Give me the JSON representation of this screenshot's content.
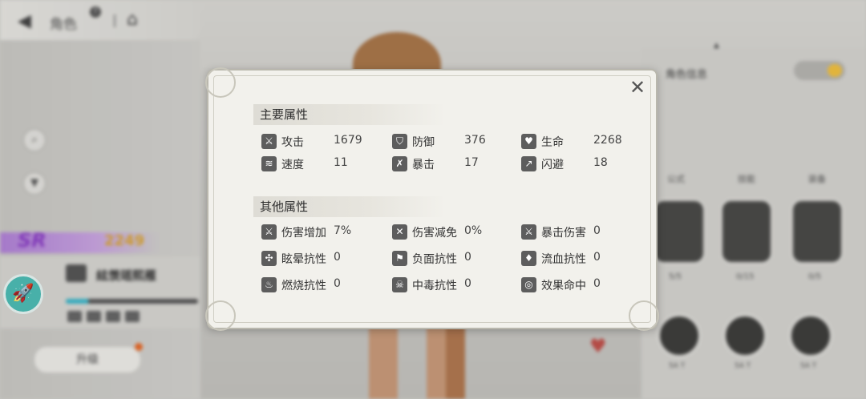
{
  "background": {
    "header": {
      "title": "角色",
      "help_badge": "?"
    },
    "left": {
      "rarity": "SR",
      "power": "2249",
      "char_name": "絃羡瑶熙雁",
      "level_progress": 0.17,
      "upgrade_label": "升级"
    },
    "right": {
      "title": "角色信息",
      "tabs": [
        "公式",
        "技能",
        "装备"
      ],
      "skill_labels": [
        "5/5",
        "0/15",
        "0/5"
      ],
      "equip_labels": [
        "5A T",
        "5A T",
        "5A T"
      ]
    }
  },
  "modal": {
    "main_title": "主要属性",
    "other_title": "其他属性",
    "main_attrs": [
      {
        "name": "攻击",
        "value": "1679",
        "icon": "sword-icon"
      },
      {
        "name": "防御",
        "value": "376",
        "icon": "shield-icon"
      },
      {
        "name": "生命",
        "value": "2268",
        "icon": "heart-icon"
      },
      {
        "name": "速度",
        "value": "11",
        "icon": "wind-icon"
      },
      {
        "name": "暴击",
        "value": "17",
        "icon": "crit-sword-icon"
      },
      {
        "name": "闪避",
        "value": "18",
        "icon": "dodge-runner-icon"
      }
    ],
    "other_attrs": [
      {
        "name": "伤害增加",
        "value": "7%",
        "icon": "damage-up-icon"
      },
      {
        "name": "伤害减免",
        "value": "0%",
        "icon": "damage-reduce-icon"
      },
      {
        "name": "暴击伤害",
        "value": "0",
        "icon": "crit-damage-icon"
      },
      {
        "name": "眩晕抗性",
        "value": "0",
        "icon": "stun-resist-icon"
      },
      {
        "name": "负面抗性",
        "value": "0",
        "icon": "debuff-resist-icon"
      },
      {
        "name": "流血抗性",
        "value": "0",
        "icon": "bleed-resist-icon"
      },
      {
        "name": "燃烧抗性",
        "value": "0",
        "icon": "burn-resist-icon"
      },
      {
        "name": "中毒抗性",
        "value": "0",
        "icon": "poison-skull-icon"
      },
      {
        "name": "效果命中",
        "value": "0",
        "icon": "effect-hit-icon"
      }
    ]
  }
}
